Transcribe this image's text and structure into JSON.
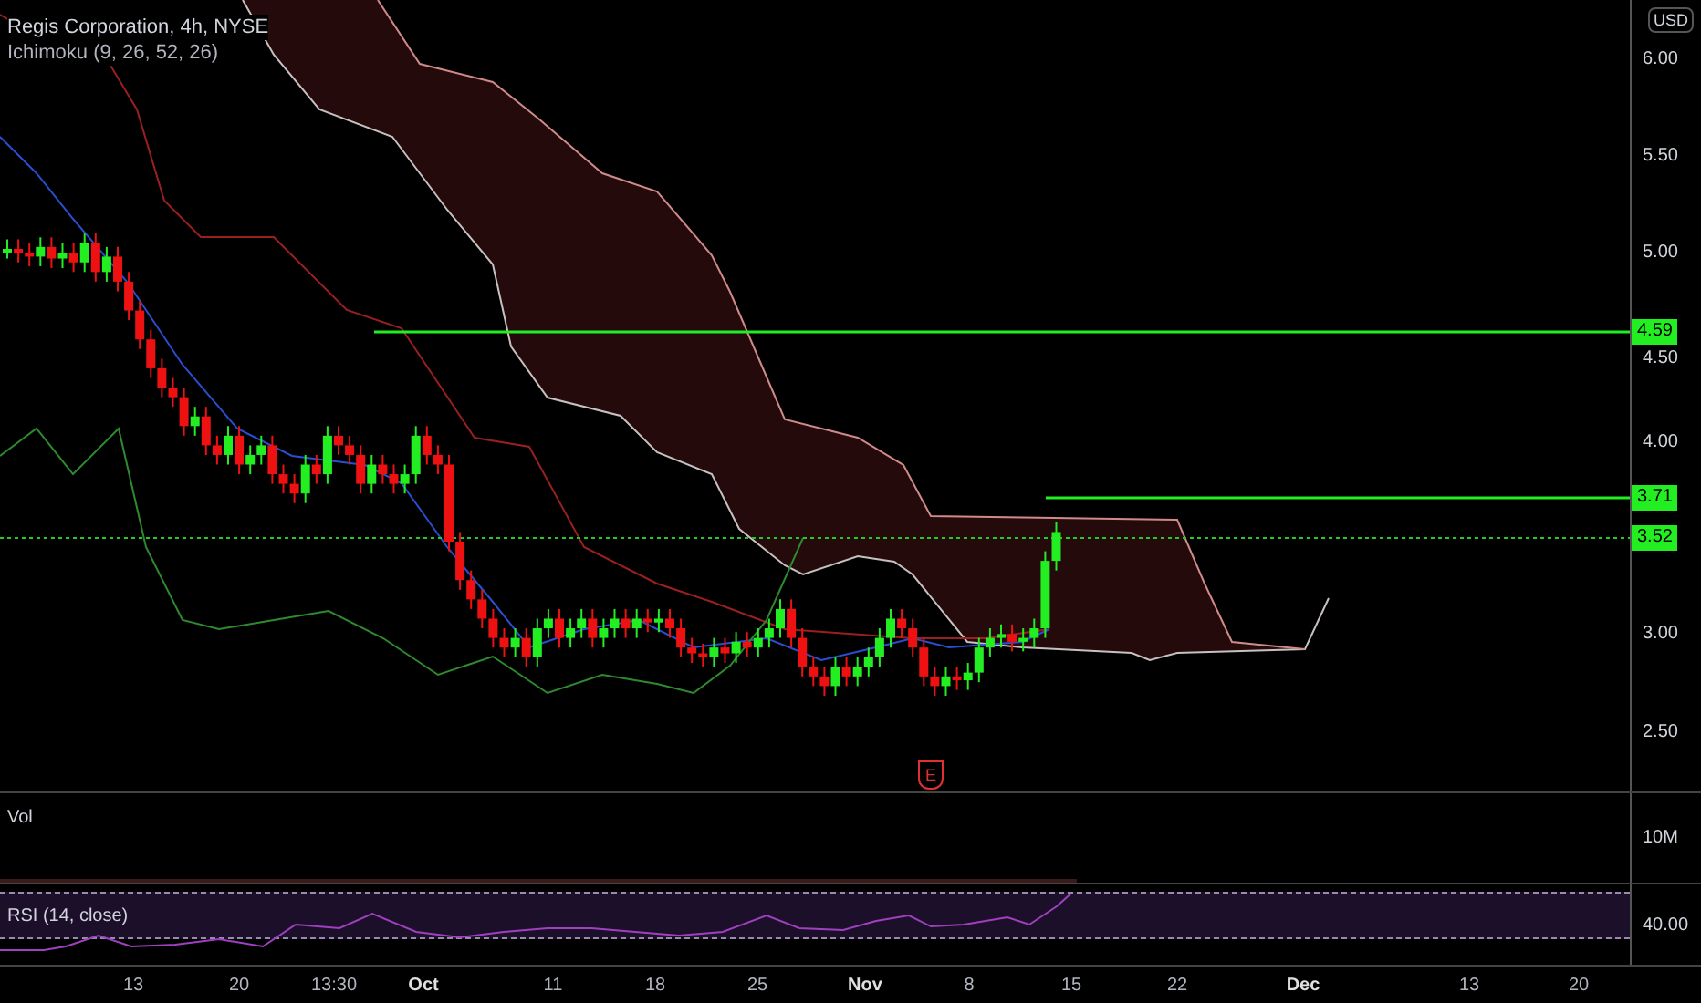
{
  "header": {
    "title": "Regis Corporation, 4h, NYSE",
    "indicator": "Ichimoku (9, 26, 52, 26)"
  },
  "currency": "USD",
  "price_axis": [
    "6.00",
    "5.50",
    "5.00",
    "4.50",
    "4.00",
    "3.00",
    "2.50"
  ],
  "levels": [
    {
      "label": "4.59",
      "kind": "solid"
    },
    {
      "label": "3.71",
      "kind": "solid"
    },
    {
      "label": "3.52",
      "kind": "dotted"
    }
  ],
  "earnings_marker": "E",
  "volume_pane": {
    "label": "Vol",
    "axis": "10M"
  },
  "rsi_pane": {
    "label": "RSI (14, close)",
    "axis": "40.00"
  },
  "time_axis": [
    {
      "label": "13",
      "kind": "day"
    },
    {
      "label": "20",
      "kind": "day"
    },
    {
      "label": "13:30",
      "kind": "time"
    },
    {
      "label": "Oct",
      "kind": "month"
    },
    {
      "label": "11",
      "kind": "day"
    },
    {
      "label": "18",
      "kind": "day"
    },
    {
      "label": "25",
      "kind": "day"
    },
    {
      "label": "Nov",
      "kind": "month"
    },
    {
      "label": "8",
      "kind": "day"
    },
    {
      "label": "15",
      "kind": "day"
    },
    {
      "label": "22",
      "kind": "day"
    },
    {
      "label": "Dec",
      "kind": "month"
    },
    {
      "label": "13",
      "kind": "day"
    },
    {
      "label": "20",
      "kind": "day"
    }
  ]
}
